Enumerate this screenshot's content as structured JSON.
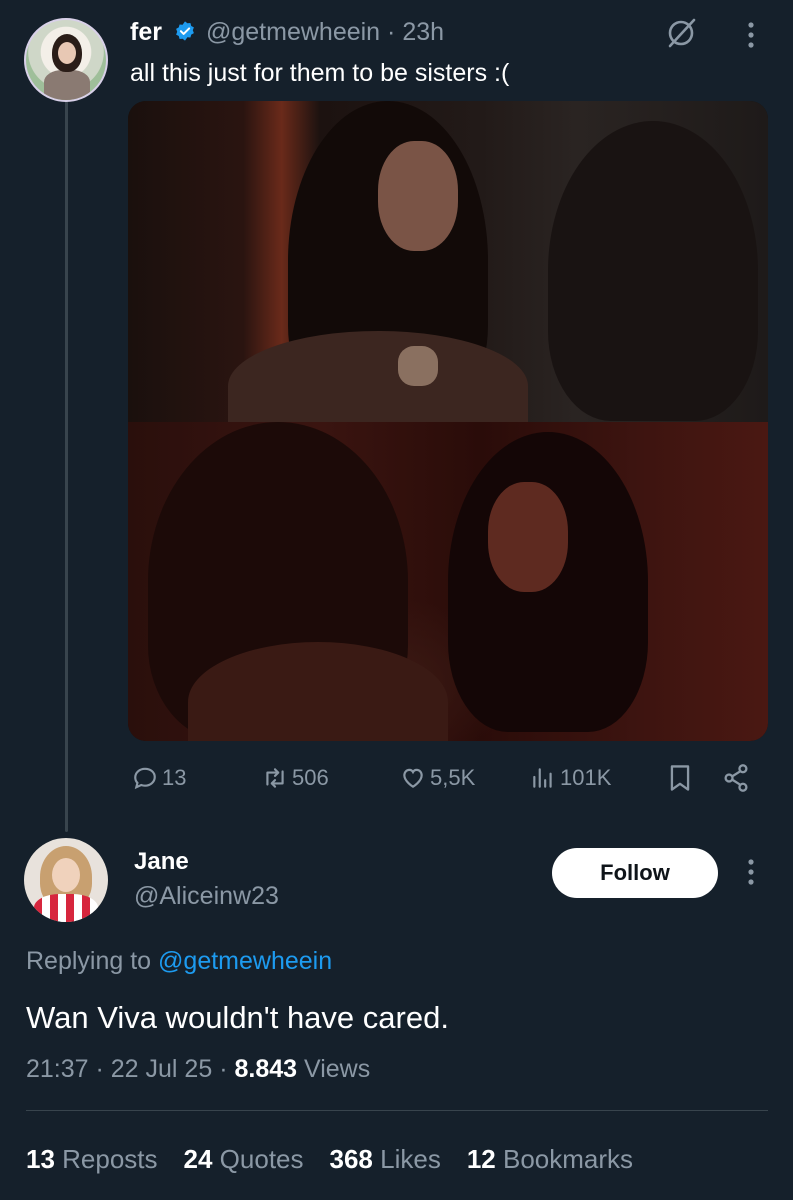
{
  "original_tweet": {
    "display_name": "fer",
    "handle": "@getmewheein",
    "time": "23h",
    "text": "all this just for them to be sisters :(",
    "media_count": 2,
    "actions": {
      "replies": "13",
      "reposts": "506",
      "likes": "5,5K",
      "views": "101K"
    }
  },
  "reply": {
    "display_name": "Jane",
    "handle": "@Aliceinw23",
    "follow_label": "Follow",
    "replying_prefix": "Replying to",
    "replying_to": "@getmewheein",
    "text": "Wan Viva wouldn't have cared.",
    "timestamp": "21:37 · 22 Jul 25 · ",
    "views_count": "8.843",
    "views_label": " Views",
    "stats": [
      {
        "count": "13",
        "label": " Reposts"
      },
      {
        "count": "24",
        "label": " Quotes"
      },
      {
        "count": "368",
        "label": " Likes"
      },
      {
        "count": "12",
        "label": " Bookmarks"
      }
    ]
  },
  "colors": {
    "background": "#15202b",
    "muted": "#8b98a5",
    "accent": "#1d9bf0",
    "divider": "#38444d"
  },
  "icons": [
    "verified-badge-icon",
    "grok-icon",
    "more-icon",
    "reply-icon",
    "repost-icon",
    "like-icon",
    "views-icon",
    "bookmark-icon",
    "share-icon"
  ]
}
